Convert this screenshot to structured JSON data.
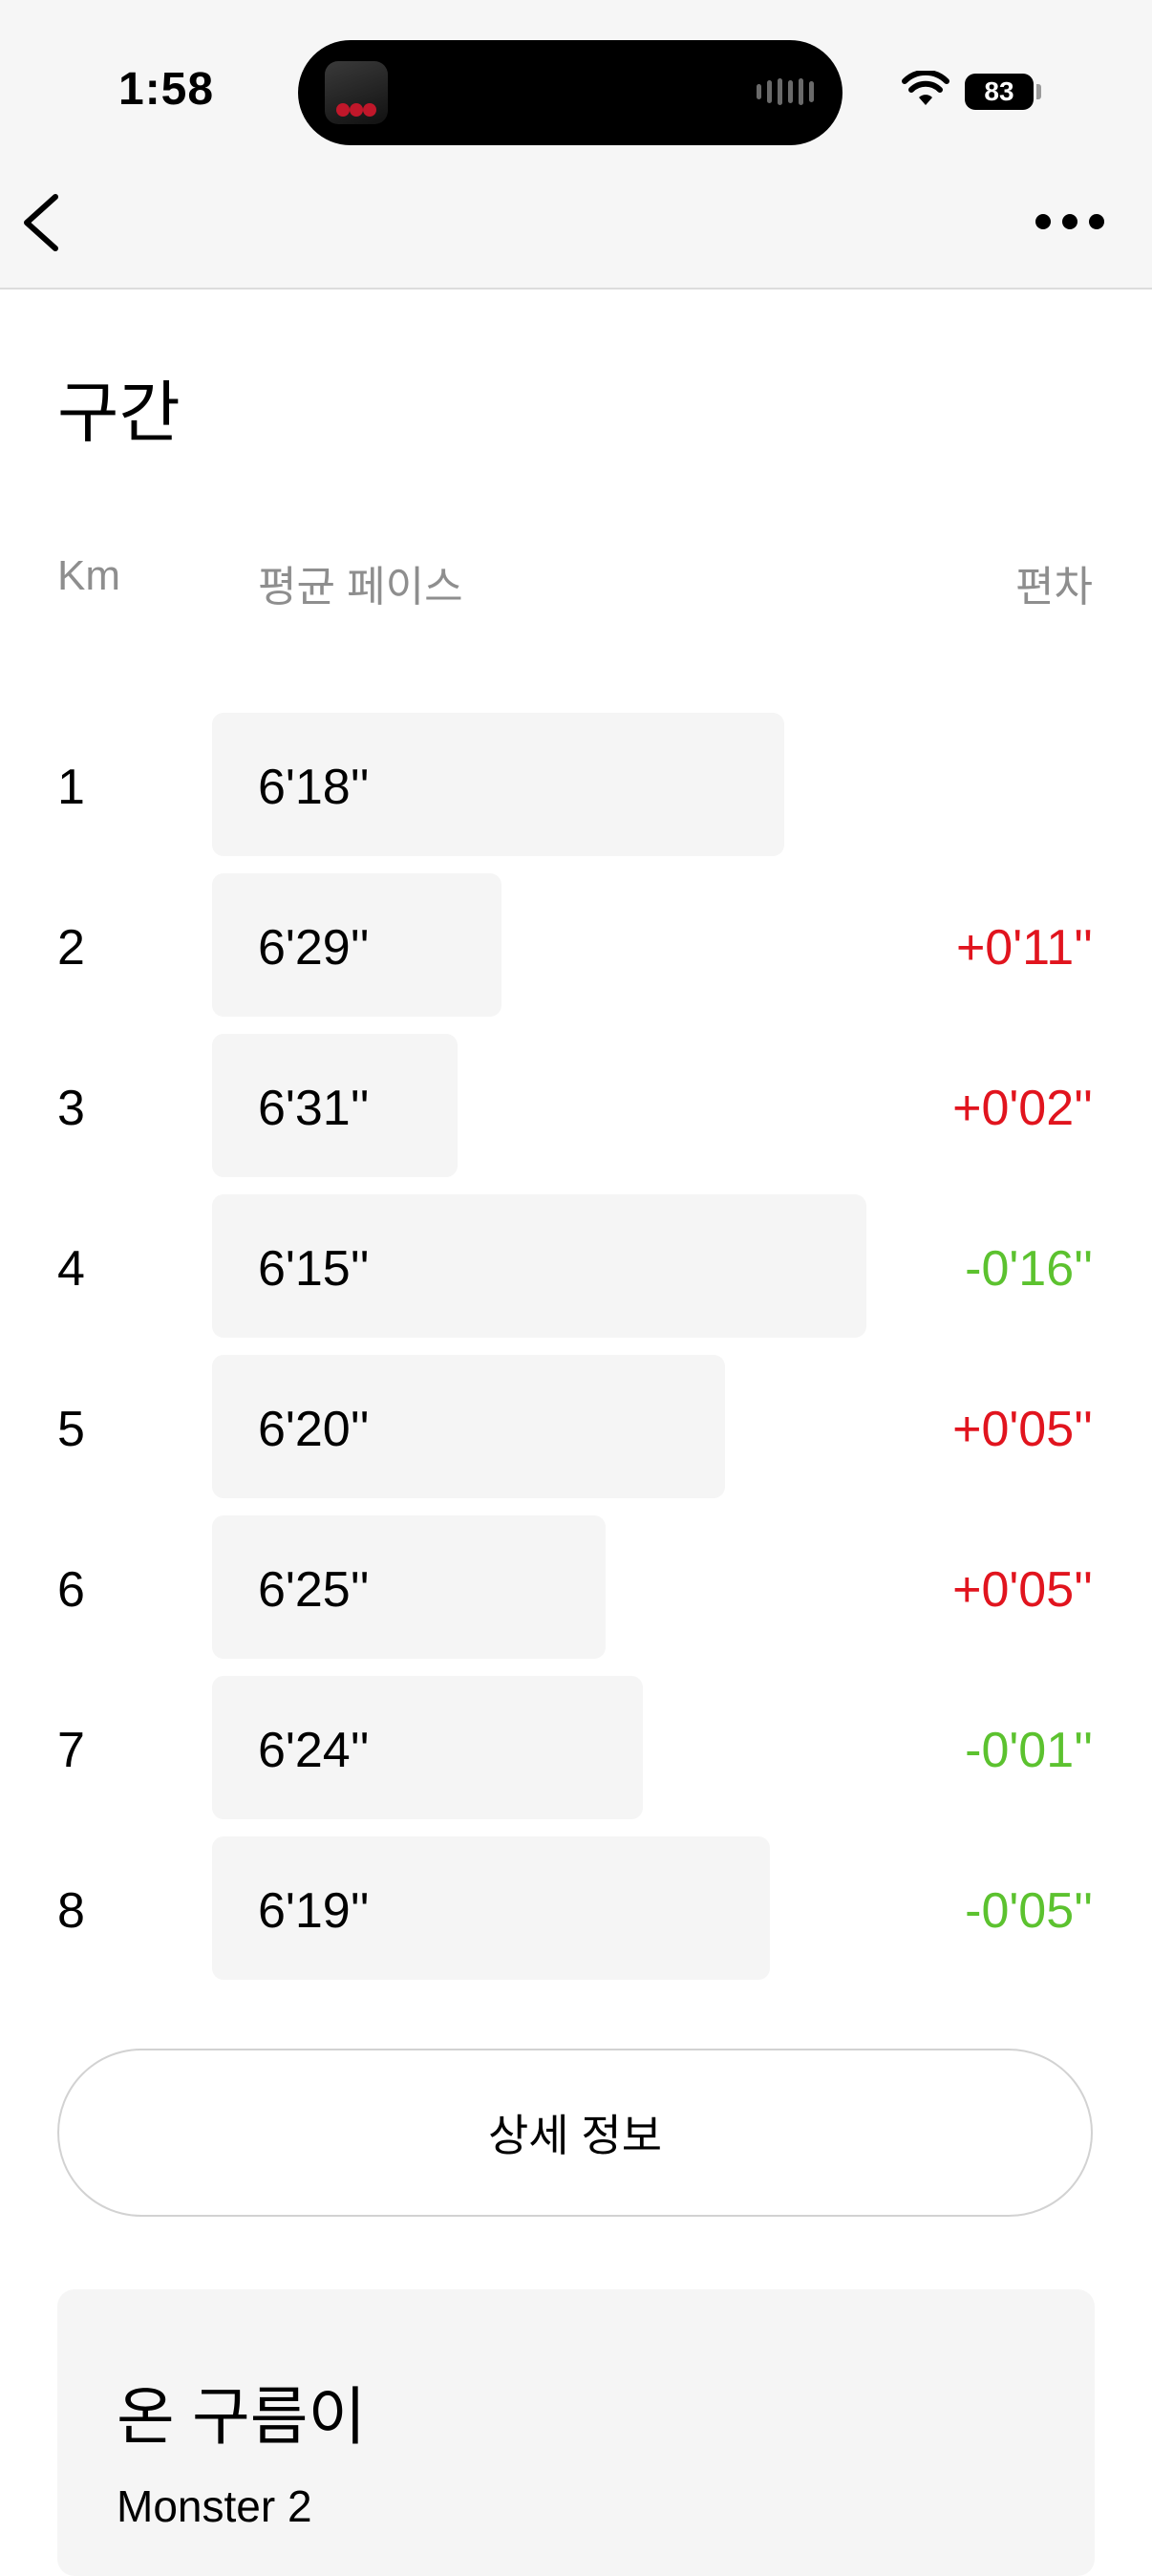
{
  "status_bar": {
    "time": "1:58",
    "battery": "83"
  },
  "nav": {
    "back_icon": "chevron-left-icon",
    "more_icon": "more-horizontal-icon"
  },
  "section": {
    "title": "구간",
    "columns": {
      "km": "Km",
      "pace": "평균 페이스",
      "deviation": "편차"
    }
  },
  "splits": [
    {
      "km": "1",
      "pace": "6'18''",
      "deviation": "",
      "trend": "none",
      "bar_fraction": 0.77
    },
    {
      "km": "2",
      "pace": "6'29''",
      "deviation": "+0'11''",
      "trend": "up",
      "bar_fraction": 0.39
    },
    {
      "km": "3",
      "pace": "6'31''",
      "deviation": "+0'02''",
      "trend": "up",
      "bar_fraction": 0.33
    },
    {
      "km": "4",
      "pace": "6'15''",
      "deviation": "-0'16''",
      "trend": "down",
      "bar_fraction": 0.88
    },
    {
      "km": "5",
      "pace": "6'20''",
      "deviation": "+0'05''",
      "trend": "up",
      "bar_fraction": 0.69
    },
    {
      "km": "6",
      "pace": "6'25''",
      "deviation": "+0'05''",
      "trend": "up",
      "bar_fraction": 0.53
    },
    {
      "km": "7",
      "pace": "6'24''",
      "deviation": "-0'01''",
      "trend": "down",
      "bar_fraction": 0.58
    },
    {
      "km": "8",
      "pace": "6'19''",
      "deviation": "-0'05''",
      "trend": "down",
      "bar_fraction": 0.75
    }
  ],
  "colors": {
    "slower": "#e1141e",
    "faster": "#5cc22f",
    "bar": "#f5f5f5"
  },
  "detail_button": {
    "label": "상세 정보"
  },
  "card": {
    "title": "온 구름이",
    "subtitle": "Monster 2"
  }
}
